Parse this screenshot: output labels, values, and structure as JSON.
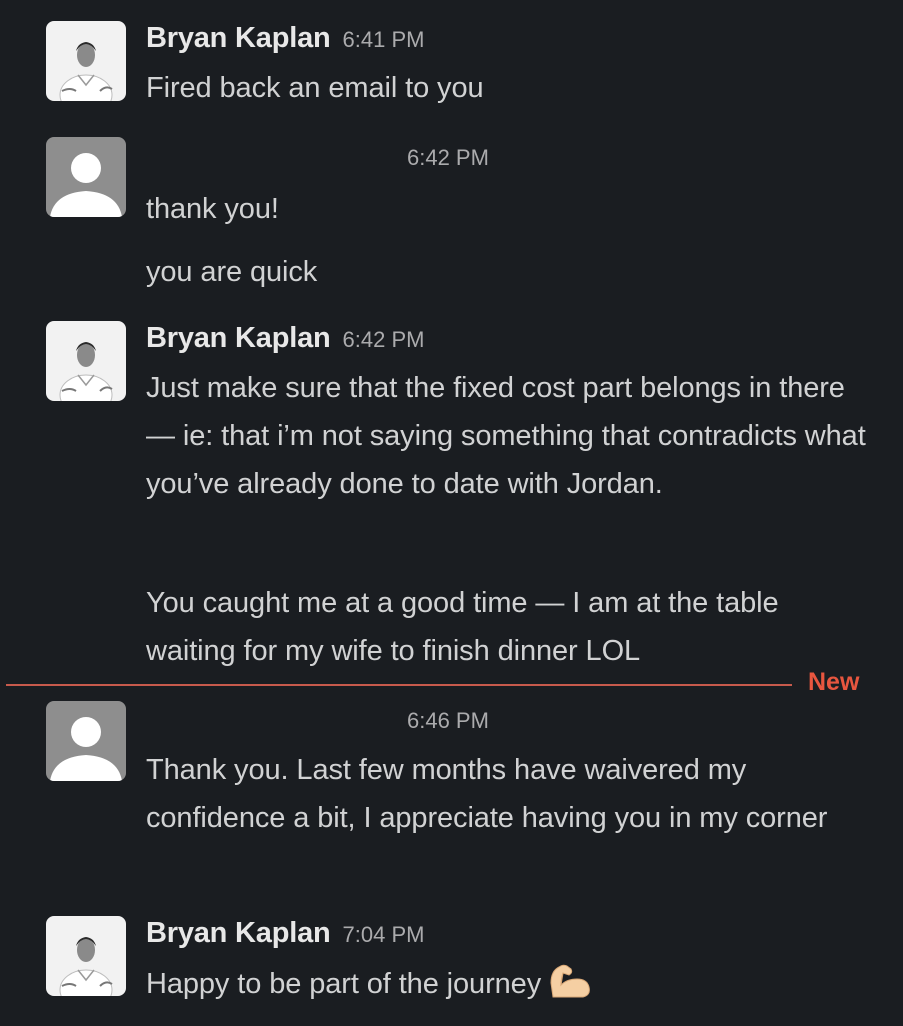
{
  "messages": [
    {
      "author": "Bryan Kaplan",
      "time": "6:41 PM",
      "lines": [
        "Fired back an email to you"
      ],
      "avatar": "user-photo-icon"
    },
    {
      "author": "",
      "time": "6:42 PM",
      "lines": [
        "thank you!",
        "you are quick"
      ],
      "avatar": "default-user-icon"
    },
    {
      "author": "Bryan Kaplan",
      "time": "6:42 PM",
      "lines": [
        "Just make sure that the fixed cost part belongs in there — ie: that i’m not saying something that contradicts what you’ve already done to date with Jordan.",
        "You caught me at a good time — I am at the table waiting for my wife to finish dinner LOL"
      ],
      "avatar": "user-photo-icon"
    },
    {
      "author": "",
      "time": "6:46 PM",
      "lines": [
        "Thank you. Last few months have waivered my confidence a bit, I appreciate having you in my corner"
      ],
      "avatar": "default-user-icon"
    },
    {
      "author": "Bryan Kaplan",
      "time": "7:04 PM",
      "lines": [
        "Happy to be part of the journey"
      ],
      "emoji": "flexed-biceps-icon",
      "avatar": "user-photo-icon"
    }
  ],
  "divider": {
    "label": "New",
    "color": "#e8563f"
  },
  "colors": {
    "background": "#1a1d21",
    "text": "#d1d2d3",
    "timestamp": "#ababad",
    "author": "#e8e8e8"
  }
}
